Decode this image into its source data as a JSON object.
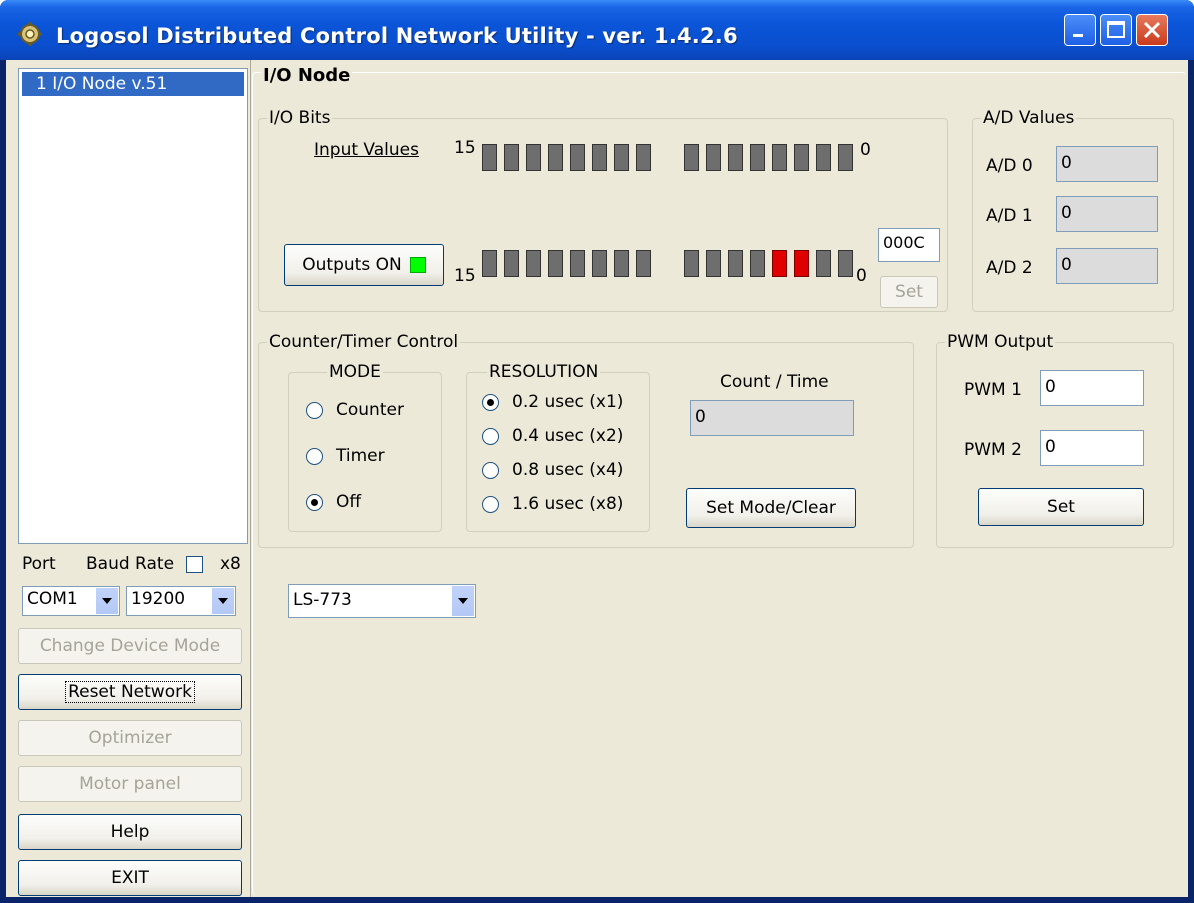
{
  "window": {
    "title": "Logosol Distributed Control Network Utility - ver. 1.4.2.6"
  },
  "sidebar": {
    "node_list": [
      "1 I/O Node v.51"
    ],
    "port_label": "Port",
    "baud_label": "Baud Rate",
    "x8_label": "x8",
    "port_value": "COM1",
    "baud_value": "19200",
    "buttons": {
      "change_mode": "Change Device Mode",
      "reset": "Reset Network",
      "optimizer": "Optimizer",
      "motor": "Motor panel",
      "help": "Help",
      "exit": "EXIT"
    }
  },
  "io_node": {
    "title": "I/O Node",
    "io_bits": {
      "title": "I/O Bits",
      "input_label": "Input Values",
      "high_bit": "15",
      "low_bit": "0",
      "outputs_button": "Outputs ON",
      "output_hex": "000C",
      "set_label": "Set",
      "input_bits": [
        0,
        0,
        0,
        0,
        0,
        0,
        0,
        0,
        0,
        0,
        0,
        0,
        0,
        0,
        0,
        0
      ],
      "output_bits": [
        0,
        0,
        0,
        0,
        0,
        0,
        0,
        0,
        0,
        0,
        0,
        0,
        1,
        1,
        0,
        0
      ]
    },
    "ad_values": {
      "title": "A/D Values",
      "items": [
        {
          "label": "A/D 0",
          "value": "0"
        },
        {
          "label": "A/D 1",
          "value": "0"
        },
        {
          "label": "A/D 2",
          "value": "0"
        }
      ]
    },
    "counter": {
      "title": "Counter/Timer Control",
      "mode_title": "MODE",
      "modes": [
        "Counter",
        "Timer",
        "Off"
      ],
      "mode_selected": "Off",
      "resolution_title": "RESOLUTION",
      "resolutions": [
        "0.2 usec (x1)",
        "0.4 usec (x2)",
        "0.8 usec (x4)",
        "1.6 usec (x8)"
      ],
      "resolution_selected": "0.2 usec (x1)",
      "count_label": "Count / Time",
      "count_value": "0",
      "set_mode_button": "Set Mode/Clear"
    },
    "pwm": {
      "title": "PWM Output",
      "pwm1_label": "PWM 1",
      "pwm1_value": "0",
      "pwm2_label": "PWM 2",
      "pwm2_value": "0",
      "set_button": "Set"
    },
    "device_select": "LS-773"
  },
  "colors": {
    "titlebar": "#0b55d8",
    "face": "#ece9d8",
    "selection": "#316ac5",
    "bit_on": "#e10000",
    "led": "#00ff00"
  }
}
